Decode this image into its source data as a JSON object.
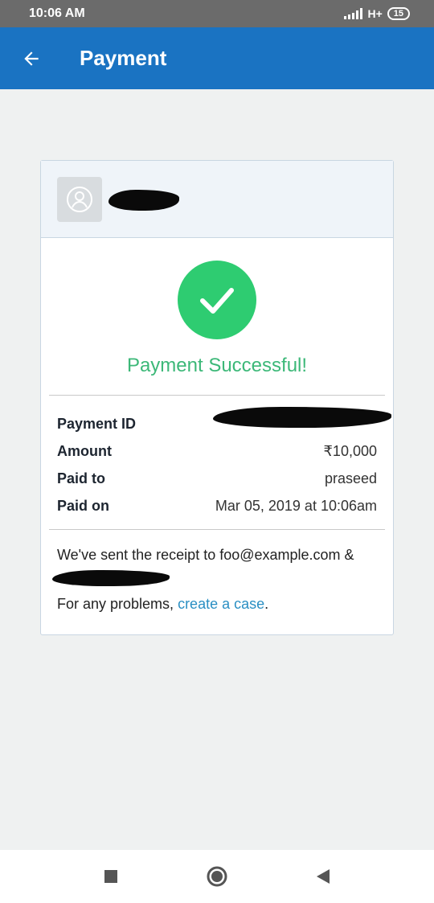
{
  "status_bar": {
    "time": "10:06 AM",
    "network": "H+",
    "battery": "15"
  },
  "app_bar": {
    "title": "Payment",
    "back_icon": "arrow-left-icon"
  },
  "merchant": {
    "avatar_icon": "user-icon"
  },
  "result": {
    "icon": "check-icon",
    "message": "Payment Successful!",
    "color": "#2ecc71"
  },
  "details": [
    {
      "label": "Payment ID",
      "value": ""
    },
    {
      "label": "Amount",
      "value": "₹10,000"
    },
    {
      "label": "Paid to",
      "value": "praseed"
    },
    {
      "label": "Paid on",
      "value": "Mar 05, 2019 at 10:06am"
    }
  ],
  "footer": {
    "receipt_text": "We've sent the receipt to foo@example.com &",
    "problems_text": "For any problems, ",
    "link_text": "create a case",
    "period": "."
  },
  "nav_bar": {
    "recents_icon": "square-icon",
    "home_icon": "circle-icon",
    "back_icon": "triangle-back-icon"
  }
}
